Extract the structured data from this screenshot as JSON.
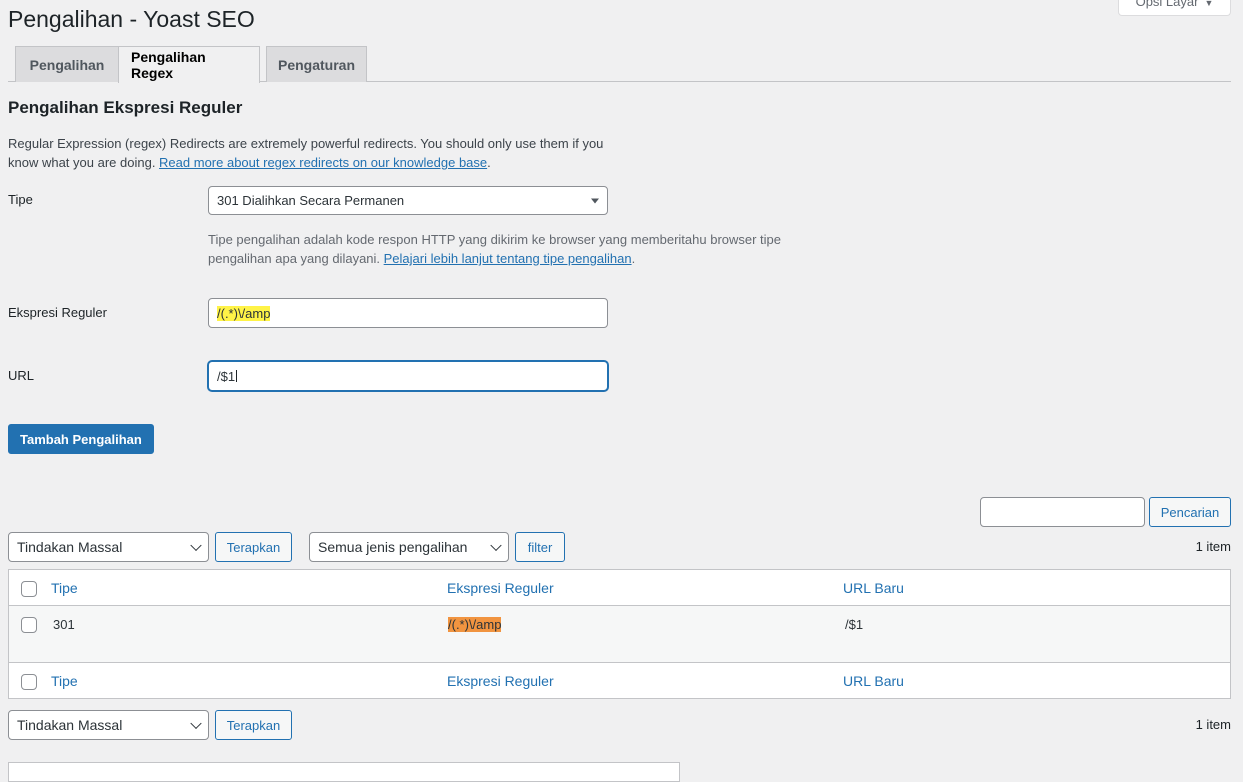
{
  "page": {
    "title": "Pengalihan - Yoast SEO",
    "screen_options": "Opsi Layar"
  },
  "tabs": [
    {
      "label": "Pengalihan",
      "active": false
    },
    {
      "label": "Pengalihan Regex",
      "active": true
    },
    {
      "label": "Pengaturan",
      "active": false
    }
  ],
  "section": {
    "title": "Pengalihan Ekspresi Reguler",
    "intro_text": "Regular Expression (regex) Redirects are extremely powerful redirects. You should only use them if you know what you are doing. ",
    "intro_link": "Read more about regex redirects on our knowledge base",
    "intro_end": "."
  },
  "form": {
    "type_label": "Tipe",
    "type_value": "301 Dialihkan Secara Permanen",
    "type_help": "Tipe pengalihan adalah kode respon HTTP yang dikirim ke browser yang memberitahu browser tipe pengalihan apa yang dilayani. ",
    "type_help_link": "Pelajari lebih lanjut tentang tipe pengalihan",
    "type_help_end": ".",
    "regex_label": "Ekspresi Reguler",
    "regex_value": "/(.*)\\/amp",
    "url_label": "URL",
    "url_value": "/$1",
    "submit_label": "Tambah Pengalihan"
  },
  "search": {
    "value": "",
    "button": "Pencarian"
  },
  "bulk_top": {
    "action": "Tindakan Massal",
    "apply": "Terapkan",
    "filter_select": "Semua jenis pengalihan",
    "filter_button": "filter",
    "count": "1 item"
  },
  "table": {
    "columns": [
      "Tipe",
      "Ekspresi Reguler",
      "URL Baru"
    ],
    "rows": [
      {
        "type": "301",
        "regex": "/(.*)\\/amp",
        "url": "/$1"
      }
    ]
  },
  "bulk_bottom": {
    "action": "Tindakan Massal",
    "apply": "Terapkan",
    "count": "1 item"
  },
  "colors": {
    "accent": "#2271b1",
    "regex_highlight_input": "#fff347",
    "regex_highlight_table": "#f19440"
  }
}
